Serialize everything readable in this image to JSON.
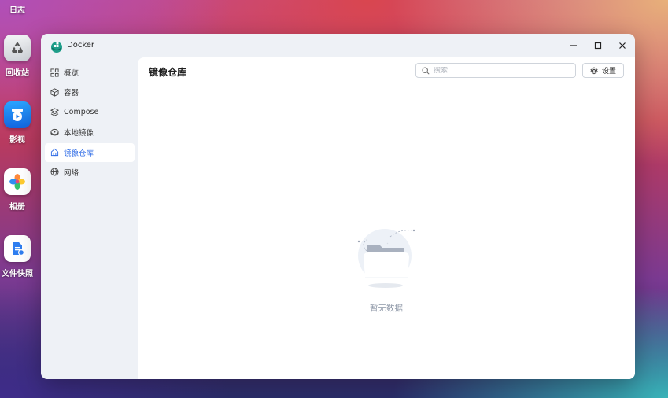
{
  "desktop": {
    "items": [
      {
        "label": "日志"
      },
      {
        "label": "回收站",
        "icon": "recycle-bin-icon"
      },
      {
        "label": "影视",
        "icon": "video-icon"
      },
      {
        "label": "相册",
        "icon": "photos-icon"
      },
      {
        "label": "文件快照",
        "icon": "file-snapshot-icon"
      }
    ]
  },
  "window": {
    "title": "Docker",
    "controls": [
      "minimize",
      "maximize",
      "close"
    ]
  },
  "sidebar": {
    "items": [
      {
        "label": "概览",
        "icon": "grid-icon",
        "active": false
      },
      {
        "label": "容器",
        "icon": "cube-icon",
        "active": false
      },
      {
        "label": "Compose",
        "icon": "layers-icon",
        "active": false
      },
      {
        "label": "本地镜像",
        "icon": "disk-icon",
        "active": false
      },
      {
        "label": "镜像仓库",
        "icon": "home-icon",
        "active": true
      },
      {
        "label": "网络",
        "icon": "globe-icon",
        "active": false
      }
    ]
  },
  "main": {
    "title": "镜像仓库",
    "search": {
      "placeholder": "搜索",
      "value": ""
    },
    "settings_label": "设置",
    "empty_text": "暂无数据"
  },
  "colors": {
    "accent": "#2e6be6",
    "window_bg": "#eef1f6"
  }
}
